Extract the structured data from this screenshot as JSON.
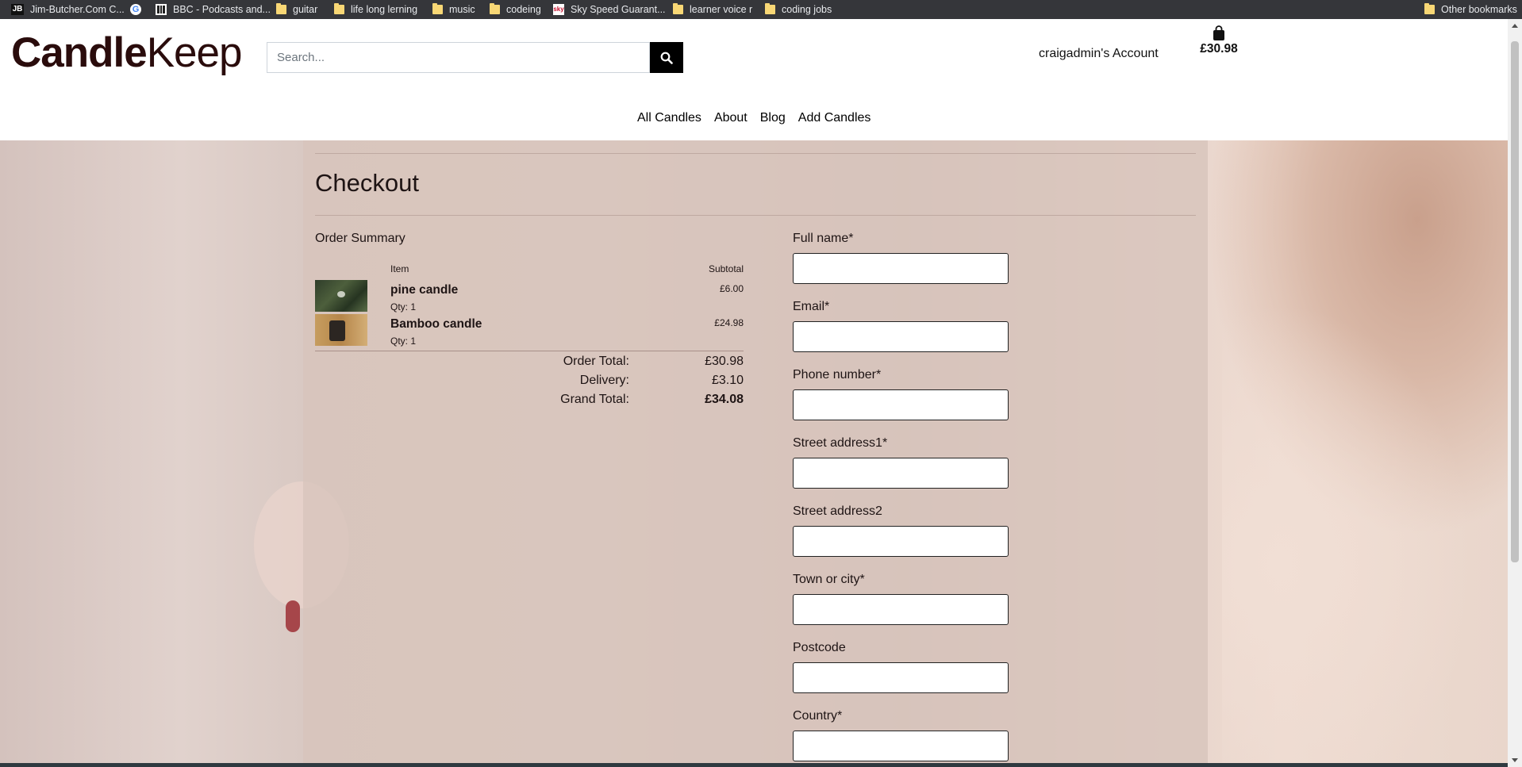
{
  "bookmarks": {
    "items": [
      {
        "label": "Jim-Butcher.Com C...",
        "icon": "jb-icon"
      },
      {
        "label": "",
        "icon": "google-icon"
      },
      {
        "label": "BBC - Podcasts and...",
        "icon": "bbc-icon"
      },
      {
        "label": "guitar",
        "icon": "folder-icon"
      },
      {
        "label": "life long lerning",
        "icon": "folder-icon"
      },
      {
        "label": "music",
        "icon": "folder-icon"
      },
      {
        "label": "codeing",
        "icon": "folder-icon"
      },
      {
        "label": "Sky Speed Guarant...",
        "icon": "sky-icon"
      },
      {
        "label": "learner voice r",
        "icon": "folder-icon"
      },
      {
        "label": "coding jobs",
        "icon": "folder-icon"
      }
    ],
    "other": "Other bookmarks"
  },
  "header": {
    "logo_bold": "Candle",
    "logo_light": "Keep",
    "search_placeholder": "Search...",
    "account": "craigadmin's Account",
    "bag_total": "£30.98"
  },
  "nav": [
    "All Candles",
    "About",
    "Blog",
    "Add Candles"
  ],
  "page_title": "Checkout",
  "order": {
    "heading": "Order Summary",
    "col_item": "Item",
    "col_subtotal": "Subtotal",
    "items": [
      {
        "name": "pine candle",
        "qty": "Qty: 1",
        "price": "£6.00"
      },
      {
        "name": "Bamboo candle",
        "qty": "Qty: 1",
        "price": "£24.98"
      }
    ],
    "totals": {
      "order_total_label": "Order Total:",
      "order_total": "£30.98",
      "delivery_label": "Delivery:",
      "delivery": "£3.10",
      "grand_total_label": "Grand Total:",
      "grand_total": "£34.08"
    }
  },
  "form": {
    "fields": [
      {
        "label": "Full name*",
        "value": ""
      },
      {
        "label": "Email*",
        "value": ""
      },
      {
        "label": "Phone number*",
        "value": ""
      },
      {
        "label": "Street address1*",
        "value": ""
      },
      {
        "label": "Street address2",
        "value": ""
      },
      {
        "label": "Town or city*",
        "value": ""
      },
      {
        "label": "Postcode",
        "value": ""
      },
      {
        "label": "Country*",
        "value": ""
      }
    ]
  },
  "colors": {
    "accent": "#000000",
    "logo": "#2a0c0c",
    "overlay": "#d8c4bc"
  }
}
